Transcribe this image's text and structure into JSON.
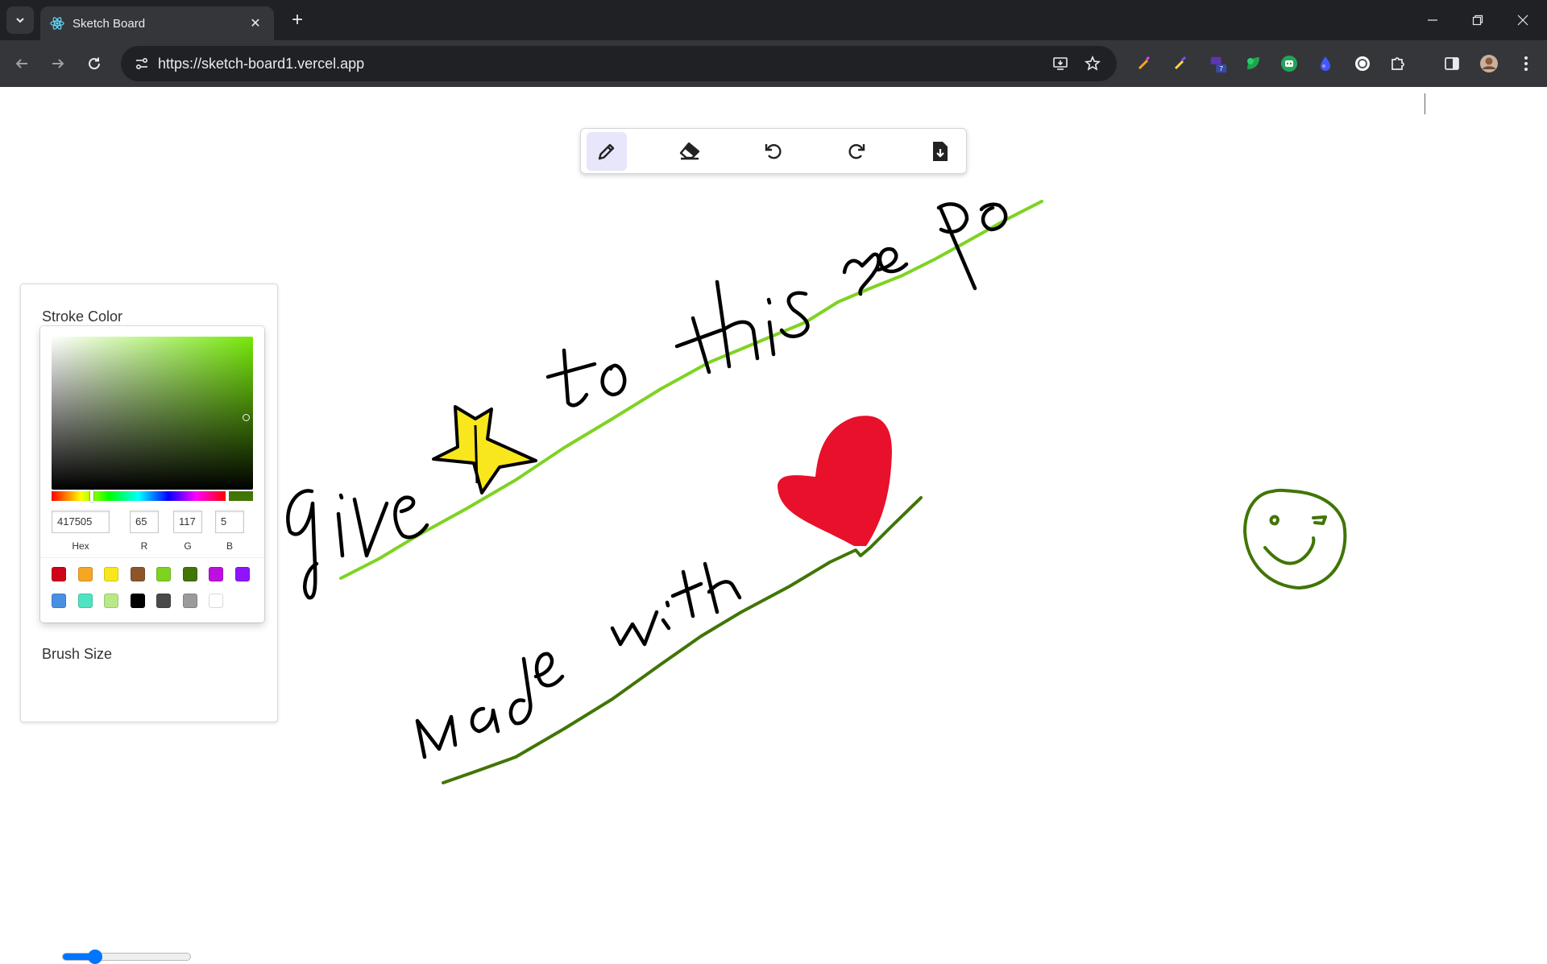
{
  "browser": {
    "tab_title": "Sketch Board",
    "url": "https://sketch-board1.vercel.app",
    "extension_badge": "7"
  },
  "app": {
    "tools": [
      "pencil-icon",
      "eraser-icon",
      "undo-icon",
      "redo-icon",
      "download-icon"
    ],
    "active_tool": "pencil",
    "stroke_color": {
      "title": "Stroke Color",
      "hex": "417505",
      "r": "65",
      "g": "117",
      "b": "5",
      "hex_label": "Hex",
      "r_label": "R",
      "g_label": "G",
      "b_label": "B",
      "presets": [
        "#D0021B",
        "#F5A623",
        "#F8E71C",
        "#8B572A",
        "#7ED321",
        "#417505",
        "#BD10E0",
        "#9013FE",
        "#4A90E2",
        "#50E3C2",
        "#B8E986",
        "#000000",
        "#4A4A4A",
        "#9B9B9B",
        "#FFFFFF"
      ]
    },
    "brush_size": {
      "title": "Brush Size",
      "value_fraction": 0.25
    }
  }
}
